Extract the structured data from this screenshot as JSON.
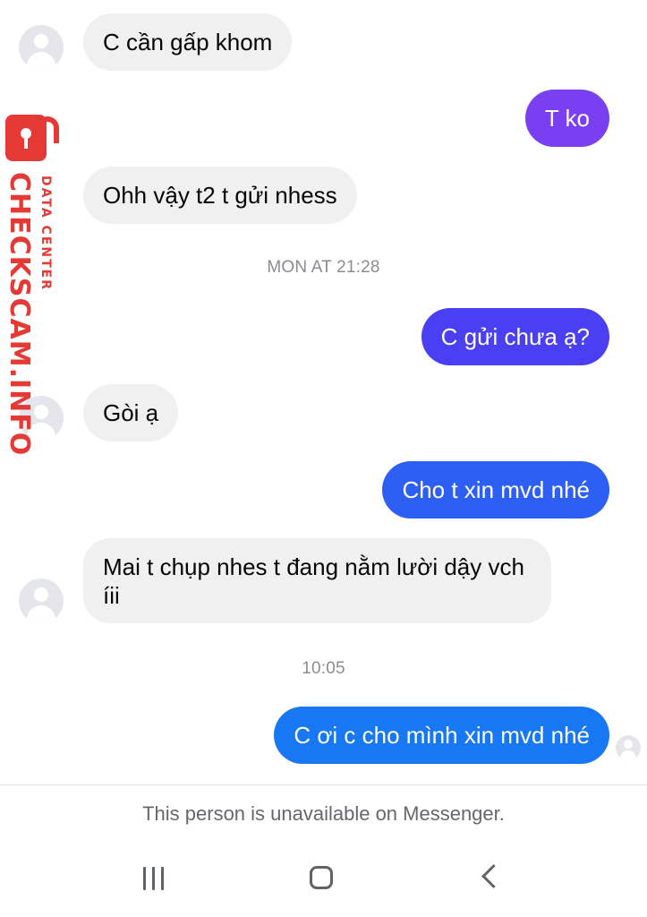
{
  "conversation": {
    "messages": [
      {
        "direction": "in",
        "text": "C cần gấp khom"
      },
      {
        "direction": "out",
        "text": "T ko",
        "color": "#7b3ff2"
      },
      {
        "direction": "in",
        "text": "Ohh vậy t2 t gửi nhess"
      },
      {
        "direction": "out",
        "text": "C gửi chưa ạ?",
        "color": "#4a3ff2"
      },
      {
        "direction": "in",
        "text": "Gòi ạ"
      },
      {
        "direction": "out",
        "text": "Cho t xin mvd nhé",
        "color": "#2d5ff5"
      },
      {
        "direction": "in",
        "text": "Mai t chụp nhes t đang nằm lười dậy vch íii"
      },
      {
        "direction": "out",
        "text": "C ơi c cho mình xin mvd nhé",
        "color": "#1877f2"
      }
    ],
    "timestamps": [
      "MON AT 21:28",
      "10:05"
    ]
  },
  "footer": {
    "unavailable_text": "This person is unavailable on Messenger."
  },
  "watermark": {
    "brand": "CHECKSCAM.INFO",
    "subtitle": "DATA CENTER",
    "color": "#e53935",
    "icon": "lock-icon"
  },
  "navigation": {
    "icons": [
      "recent-apps-icon",
      "home-icon",
      "back-icon"
    ]
  },
  "colors": {
    "incoming_bubble": "#f0f0f0",
    "text_muted": "#8a8d91"
  }
}
